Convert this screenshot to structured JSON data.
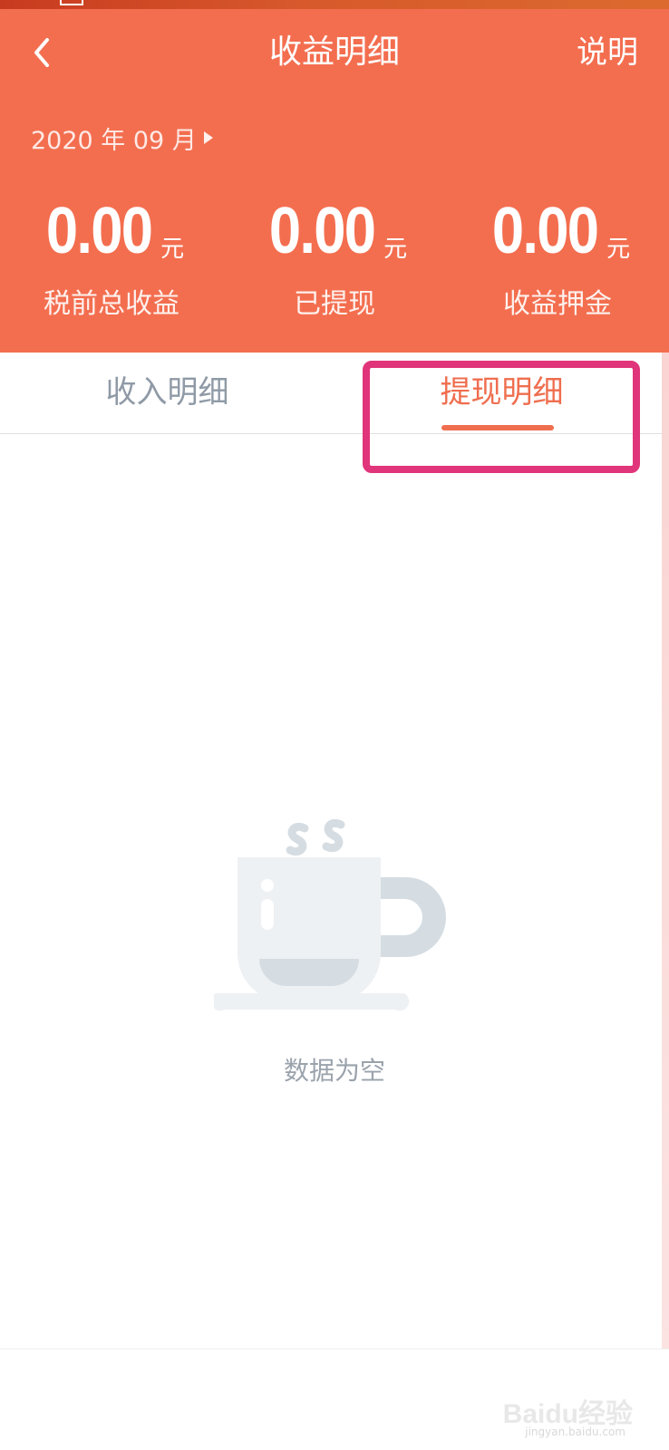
{
  "header": {
    "title": "收益明细",
    "help_label": "说明",
    "month": "2020 年 09 月",
    "background_color": "#f36e4f"
  },
  "stats": [
    {
      "value": "0.00",
      "unit": "元",
      "label": "税前总收益"
    },
    {
      "value": "0.00",
      "unit": "元",
      "label": "已提现"
    },
    {
      "value": "0.00",
      "unit": "元",
      "label": "收益押金"
    }
  ],
  "tabs": [
    {
      "label": "收入明细",
      "active": false
    },
    {
      "label": "提现明细",
      "active": true
    }
  ],
  "accent_color": "#ef6e4f",
  "highlight_color": "#e0357a",
  "empty_state": {
    "icon": "coffee-cup-icon",
    "text": "数据为空"
  },
  "watermark": {
    "text": "Baidu经验",
    "url": "jingyan.baidu.com"
  }
}
